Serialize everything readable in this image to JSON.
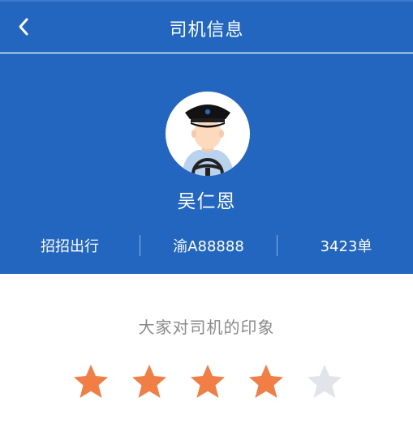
{
  "nav": {
    "title": "司机信息",
    "back_icon": "chevron-left-icon"
  },
  "driver": {
    "name": "吴仁恩",
    "company": "招招出行",
    "plate": "渝A88888",
    "orders": "3423单",
    "avatar_icon": "driver-avatar-icon"
  },
  "rating": {
    "title": "大家对司机的印象",
    "value": 4,
    "max": 5,
    "filled_color": "#f07e45",
    "empty_color": "#e1e4e8"
  },
  "colors": {
    "brand": "#2266c0",
    "background": "#ffffff"
  }
}
